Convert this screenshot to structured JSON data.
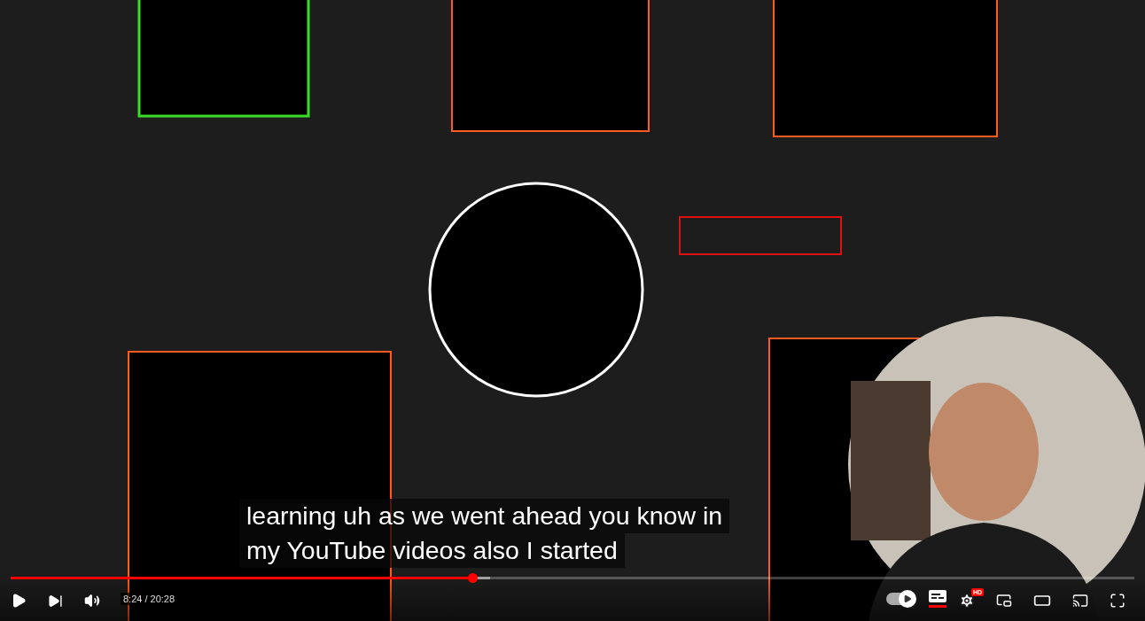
{
  "captions": [
    "learning uh as we went ahead you know in",
    "my YouTube videos also I started"
  ],
  "progress": {
    "level": 0.411
  },
  "controls": {
    "time": "8:24 / 20:28",
    "autoplay": true,
    "captions_on": true,
    "quality_badge": "HD"
  }
}
